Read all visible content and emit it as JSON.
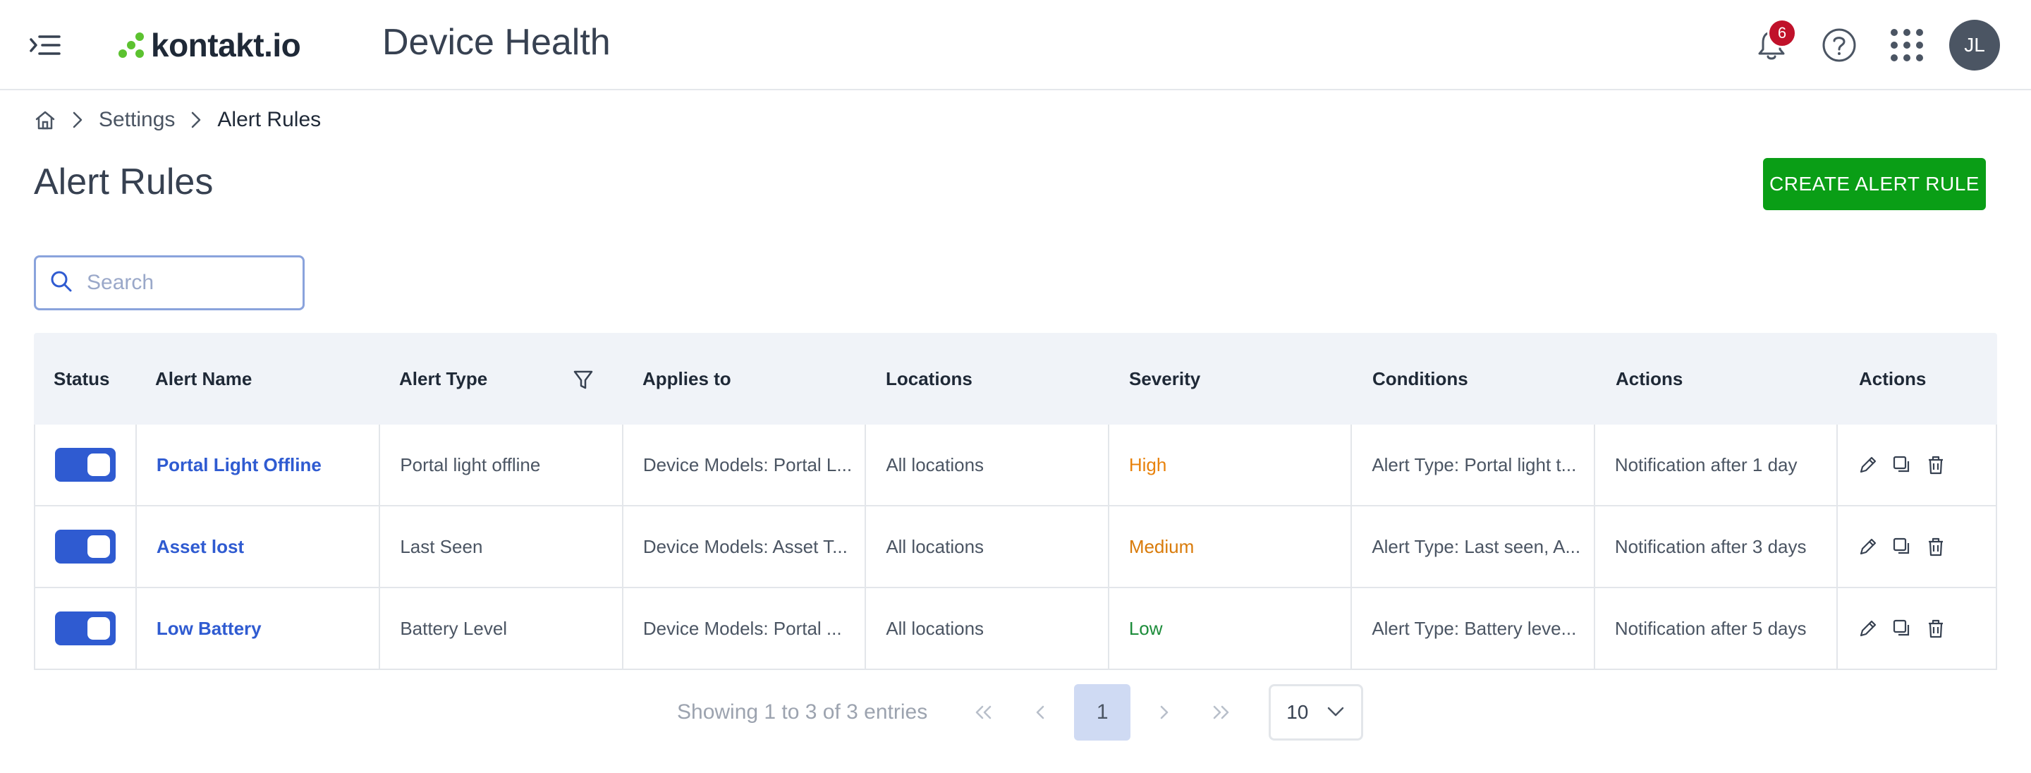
{
  "header": {
    "logo_text": "kontakt.io",
    "app_title": "Device Health",
    "notification_count": "6",
    "avatar_initials": "JL"
  },
  "breadcrumb": {
    "items": [
      "Settings",
      "Alert Rules"
    ]
  },
  "page": {
    "title": "Alert Rules",
    "create_button": "CREATE ALERT RULE"
  },
  "search": {
    "placeholder": "Search"
  },
  "table": {
    "columns": [
      "Status",
      "Alert Name",
      "Alert Type",
      "Applies to",
      "Locations",
      "Severity",
      "Conditions",
      "Actions",
      "Actions"
    ],
    "rows": [
      {
        "status": "on",
        "name": "Portal Light Offline",
        "type": "Portal light offline",
        "applies_to": "Device Models: Portal L...",
        "locations": "All locations",
        "severity": "High",
        "conditions": "Alert Type: Portal light t...",
        "actions": "Notification after 1 day"
      },
      {
        "status": "on",
        "name": "Asset lost",
        "type": "Last Seen",
        "applies_to": "Device Models: Asset T...",
        "locations": "All locations",
        "severity": "Medium",
        "conditions": "Alert Type: Last seen, A...",
        "actions": "Notification after 3 days"
      },
      {
        "status": "on",
        "name": "Low Battery",
        "type": "Battery Level",
        "applies_to": "Device Models: Portal ...",
        "locations": "All locations",
        "severity": "Low",
        "conditions": "Alert Type: Battery leve...",
        "actions": "Notification after 5 days"
      }
    ]
  },
  "pagination": {
    "info": "Showing 1 to 3 of 3 entries",
    "current_page": "1",
    "page_size": "10"
  },
  "colors": {
    "brand_green": "#0a9e16",
    "accent_blue": "#2f5bd1",
    "badge_red": "#c0112a"
  }
}
